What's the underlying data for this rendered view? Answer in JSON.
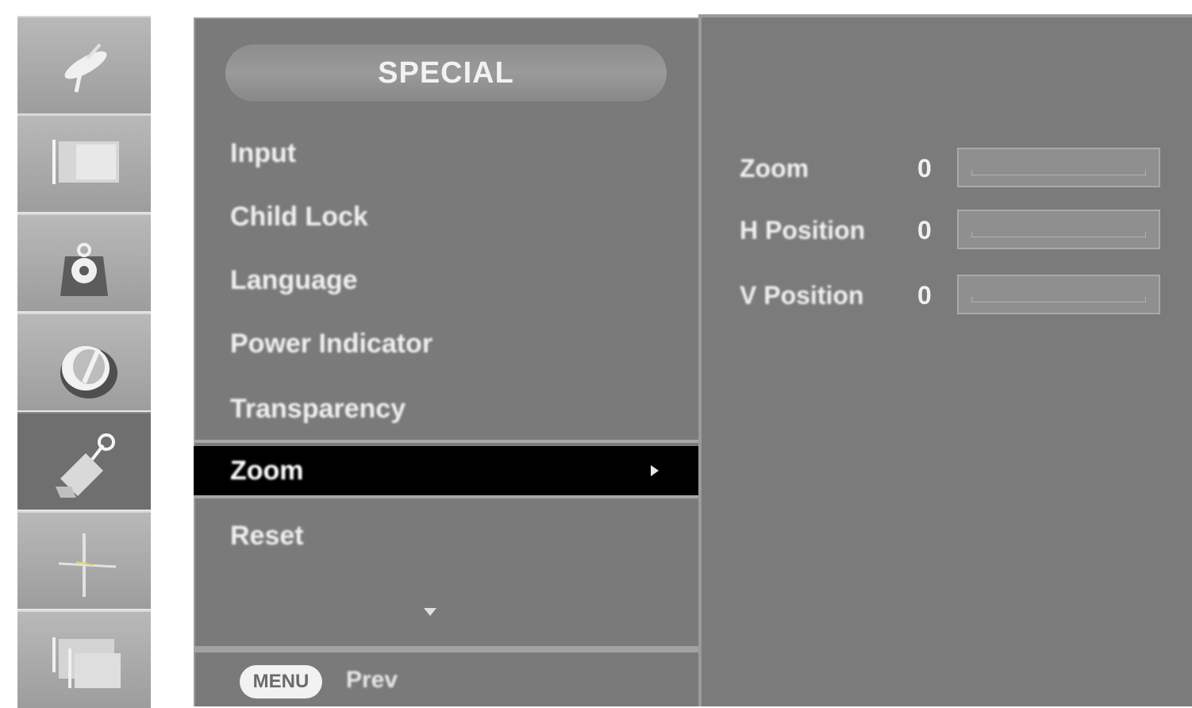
{
  "icons": [
    {
      "name": "satellite-icon"
    },
    {
      "name": "picture-icon"
    },
    {
      "name": "audio-icon"
    },
    {
      "name": "time-icon"
    },
    {
      "name": "special-icon",
      "active": true
    },
    {
      "name": "screen-position-icon"
    },
    {
      "name": "pip-icon"
    }
  ],
  "menu": {
    "title": "SPECIAL",
    "items": [
      {
        "label": "Input"
      },
      {
        "label": "Child Lock"
      },
      {
        "label": "Language"
      },
      {
        "label": "Power Indicator"
      },
      {
        "label": "Transparency"
      },
      {
        "label": "Zoom",
        "selected": true
      },
      {
        "label": "Reset"
      }
    ],
    "footer": {
      "key_label": "MENU",
      "action_label": "Prev"
    }
  },
  "submenu": {
    "rows": [
      {
        "label": "Zoom",
        "value": "0",
        "level": 0
      },
      {
        "label": "H Position",
        "value": "0",
        "level": 0
      },
      {
        "label": "V Position",
        "value": "0",
        "level": 0
      }
    ]
  },
  "colors": {
    "panel": "#7a7a7a",
    "selected_row": "#000000",
    "text": "#f0f0f0"
  }
}
